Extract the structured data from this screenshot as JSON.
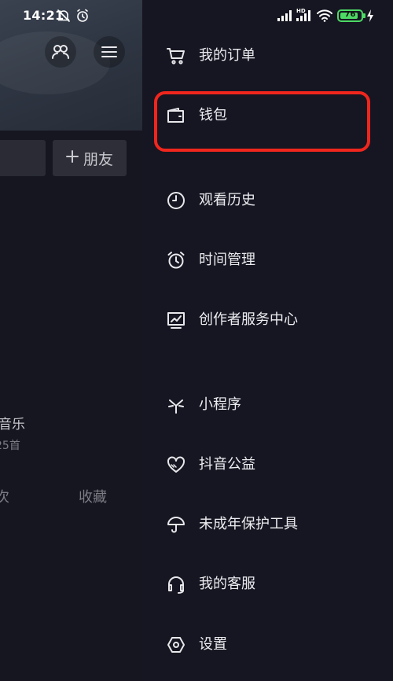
{
  "status_bar": {
    "time": "14:21",
    "signal1_label": "",
    "network_label": "HD",
    "battery_level": "76"
  },
  "background": {
    "add_friend_label": "朋友",
    "music_label": "音乐",
    "count_label": "25首",
    "tab_partial": "次",
    "tab_favorites": "收藏"
  },
  "drawer": {
    "items": [
      {
        "label": "我的订单",
        "icon": "cart-icon"
      },
      {
        "label": "钱包",
        "icon": "wallet-icon"
      },
      {
        "label": "观看历史",
        "icon": "clock-icon"
      },
      {
        "label": "时间管理",
        "icon": "alarm-icon"
      },
      {
        "label": "创作者服务中心",
        "icon": "chart-monitor-icon"
      },
      {
        "label": "小程序",
        "icon": "asterisk-icon"
      },
      {
        "label": "抖音公益",
        "icon": "heart-icon"
      },
      {
        "label": "未成年保护工具",
        "icon": "umbrella-icon"
      },
      {
        "label": "我的客服",
        "icon": "headset-icon"
      },
      {
        "label": "设置",
        "icon": "settings-hexagon-icon"
      }
    ]
  },
  "colors": {
    "highlight": "#f0261d",
    "battery": "#4cd964",
    "drawer_bg": "#161622"
  }
}
